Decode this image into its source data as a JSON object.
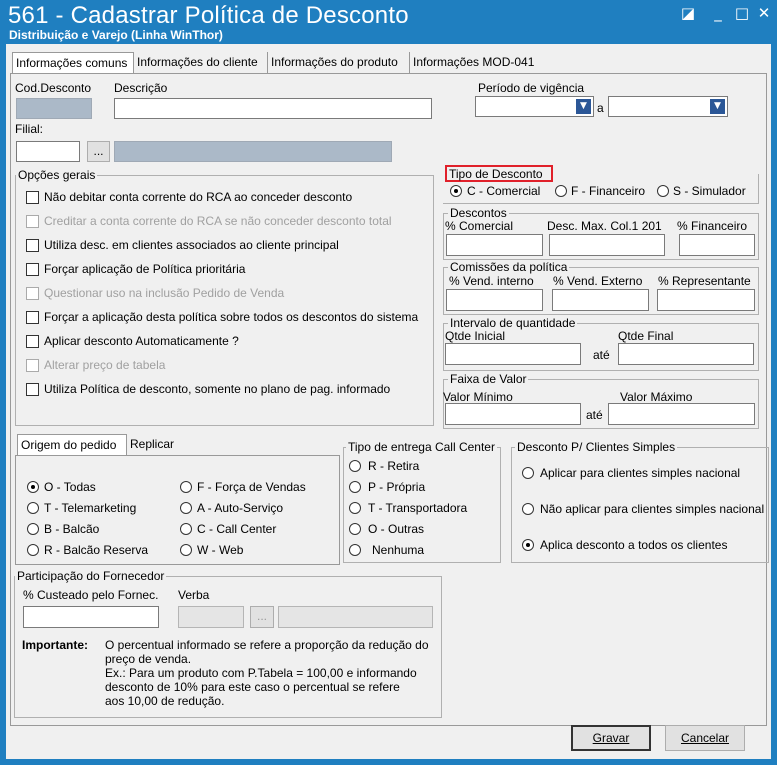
{
  "window": {
    "title": "561 - Cadastrar Política de Desconto",
    "subtitle": "Distribuição e Varejo (Linha WinThor)",
    "controls": [
      "◪",
      "_",
      "□",
      "✕"
    ]
  },
  "tabs": [
    "Informações comuns",
    "Informações do cliente",
    "Informações do produto",
    "Informações MOD-041"
  ],
  "header": {
    "cod_label": "Cod.Desconto",
    "desc_label": "Descrição",
    "periodo_label": "Período de vigência",
    "periodo_sep": "a",
    "filial_label": "Filial:",
    "filial_btn": "..."
  },
  "opcoes": {
    "title": "Opções gerais",
    "items": [
      {
        "label": "Não debitar conta corrente do RCA ao conceder desconto",
        "disabled": false
      },
      {
        "label": "Creditar a conta corrente do RCA se não conceder desconto total",
        "disabled": true
      },
      {
        "label": "Utiliza desc. em clientes associados ao cliente principal",
        "disabled": false
      },
      {
        "label": "Forçar aplicação de Política prioritária",
        "disabled": false
      },
      {
        "label": "Questionar uso na inclusão Pedido de Venda",
        "disabled": true
      },
      {
        "label": "Forçar a aplicação desta política sobre todos os descontos do sistema",
        "disabled": false
      },
      {
        "label": "Aplicar desconto Automaticamente ?",
        "disabled": false
      },
      {
        "label": "Alterar preço de tabela",
        "disabled": true
      },
      {
        "label": "Utiliza Política de desconto, somente no plano de pag. informado",
        "disabled": false
      }
    ]
  },
  "tipo_desconto": {
    "title": "Tipo de Desconto",
    "options": [
      "C - Comercial",
      "F - Financeiro",
      "S - Simulador"
    ],
    "selected": "C - Comercial",
    "highlight_color": "#e0202a"
  },
  "descontos": {
    "title": "Descontos",
    "labels": [
      "% Comercial",
      "Desc. Max. Col.1 201",
      "% Financeiro"
    ]
  },
  "comissoes": {
    "title": "Comissões da política",
    "labels": [
      "% Vend. interno",
      "% Vend. Externo",
      "% Representante"
    ]
  },
  "intervalo": {
    "title": "Intervalo de quantidade",
    "inicial": "Qtde Inicial",
    "sep": "até",
    "final": "Qtde Final"
  },
  "faixa": {
    "title": "Faixa de Valor",
    "minimo": "Valor Mínimo",
    "sep": "até",
    "maximo": "Valor Máximo"
  },
  "origem": {
    "tabs": [
      "Origem do pedido",
      "Replicar"
    ],
    "col1": [
      "O - Todas",
      "T - Telemarketing",
      "B - Balcão",
      "R - Balcão Reserva"
    ],
    "col2": [
      "F - Força de Vendas",
      "A - Auto-Serviço",
      "C - Call Center",
      "W - Web"
    ],
    "selected": "O - Todas"
  },
  "entrega": {
    "title": "Tipo de entrega Call Center",
    "options": [
      "R - Retira",
      "P - Própria",
      "T - Transportadora",
      "O - Outras",
      "Nenhuma"
    ]
  },
  "simples": {
    "title": "Desconto P/ Clientes Simples",
    "options": [
      "Aplicar para clientes simples nacional",
      "Não aplicar para clientes simples nacional",
      "Aplica desconto a todos os clientes"
    ],
    "selected": "Aplica desconto a todos os clientes"
  },
  "fornecedor": {
    "title": "Participação do Fornecedor",
    "custeado": "% Custeado pelo Fornec.",
    "verba": "Verba",
    "verba_btn": "...",
    "importante_label": "Importante:",
    "note_lines": [
      "O percentual informado se refere a proporção da redução do",
      "preço de venda.",
      "Ex.: Para um produto com P.Tabela = 100,00 e informando",
      "desconto de 10% para este caso o percentual se refere",
      "aos 10,00 de redução."
    ]
  },
  "footer": {
    "gravar": "Gravar",
    "cancelar": "Cancelar"
  }
}
